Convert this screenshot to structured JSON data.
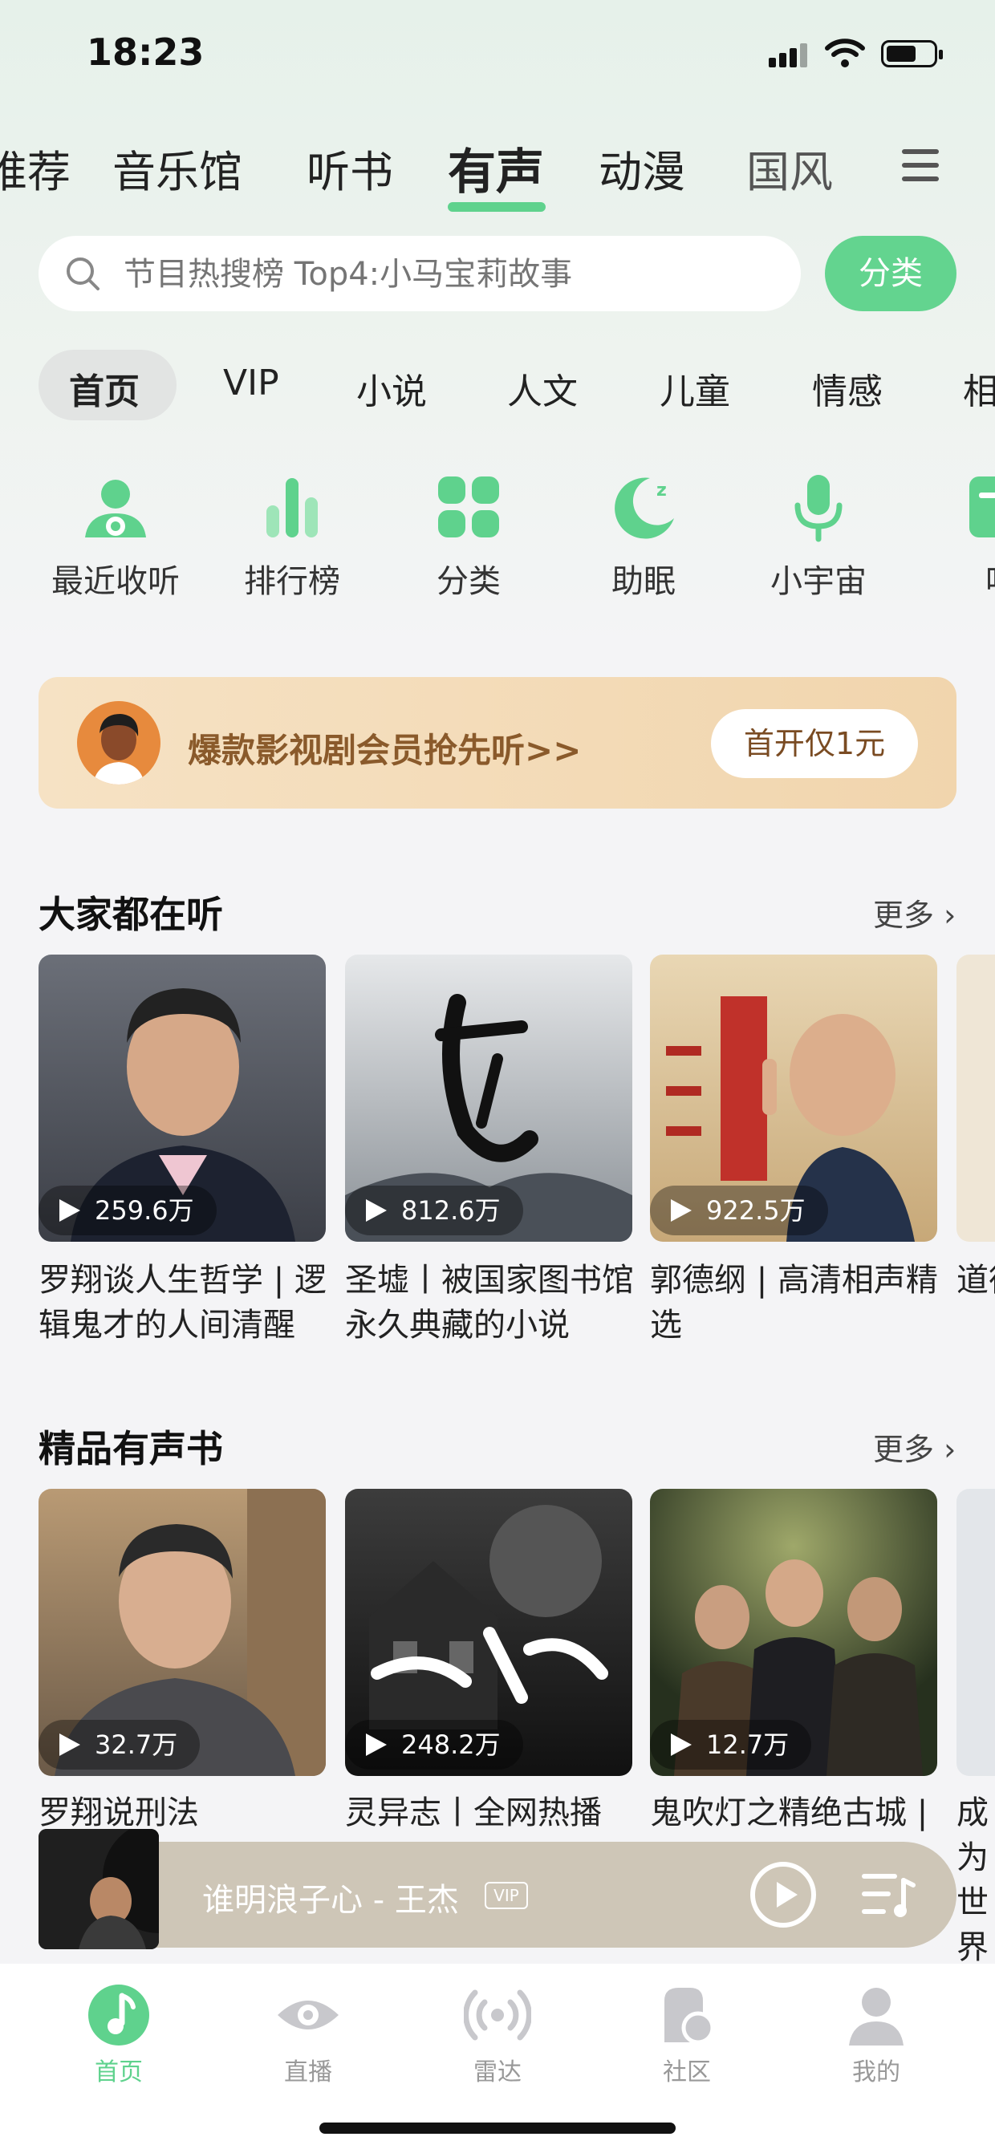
{
  "status_bar": {
    "time": "18:23"
  },
  "top_tabs": [
    {
      "label": "推荐"
    },
    {
      "label": "音乐馆"
    },
    {
      "label": "听书"
    },
    {
      "label": "有声",
      "active": true
    },
    {
      "label": "动漫"
    },
    {
      "label": "国风"
    }
  ],
  "search": {
    "placeholder": "节目热搜榜 Top4:小马宝莉故事",
    "category_label": "分类"
  },
  "sub_tabs": [
    {
      "label": "首页",
      "active": true
    },
    {
      "label": "VIP"
    },
    {
      "label": "小说"
    },
    {
      "label": "人文"
    },
    {
      "label": "儿童"
    },
    {
      "label": "情感"
    },
    {
      "label": "相"
    }
  ],
  "quick_entries": [
    {
      "label": "最近收听",
      "icon": "person-headphone-icon"
    },
    {
      "label": "排行榜",
      "icon": "chart-bars-icon"
    },
    {
      "label": "分类",
      "icon": "grid-icon"
    },
    {
      "label": "助眠",
      "icon": "moon-icon"
    },
    {
      "label": "小宇宙",
      "icon": "microphone-icon"
    },
    {
      "label": "听",
      "icon": "book-icon"
    }
  ],
  "banner": {
    "text": "爆款影视剧会员抢先听>>",
    "button": "首开仅1元"
  },
  "section_popular": {
    "title": "大家都在听",
    "more": "更多",
    "items": [
      {
        "count": "259.6万",
        "title": "罗翔谈人生哲学 | 逻辑鬼才的人间清醒"
      },
      {
        "count": "812.6万",
        "title": "圣墟丨被国家图书馆永久典藏的小说"
      },
      {
        "count": "922.5万",
        "title": "郭德纲 | 高清相声精选"
      },
      {
        "count": "",
        "title": "道德"
      }
    ]
  },
  "section_books": {
    "title": "精品有声书",
    "more": "更多",
    "items": [
      {
        "count": "32.7万",
        "title": "罗翔说刑法"
      },
      {
        "count": "248.2万",
        "title": "灵异志丨全网热播"
      },
      {
        "count": "12.7万",
        "title": "鬼吹灯之精绝古城 |"
      },
      {
        "count": "",
        "title": "成为世界"
      }
    ]
  },
  "player": {
    "song": "谁明浪子心 - 王杰",
    "vip": "VIP"
  },
  "bottom_nav": [
    {
      "label": "首页",
      "active": true
    },
    {
      "label": "直播"
    },
    {
      "label": "雷达"
    },
    {
      "label": "社区"
    },
    {
      "label": "我的"
    }
  ],
  "colors": {
    "accent": "#63d48f",
    "banner_text": "#8a5a2b"
  }
}
